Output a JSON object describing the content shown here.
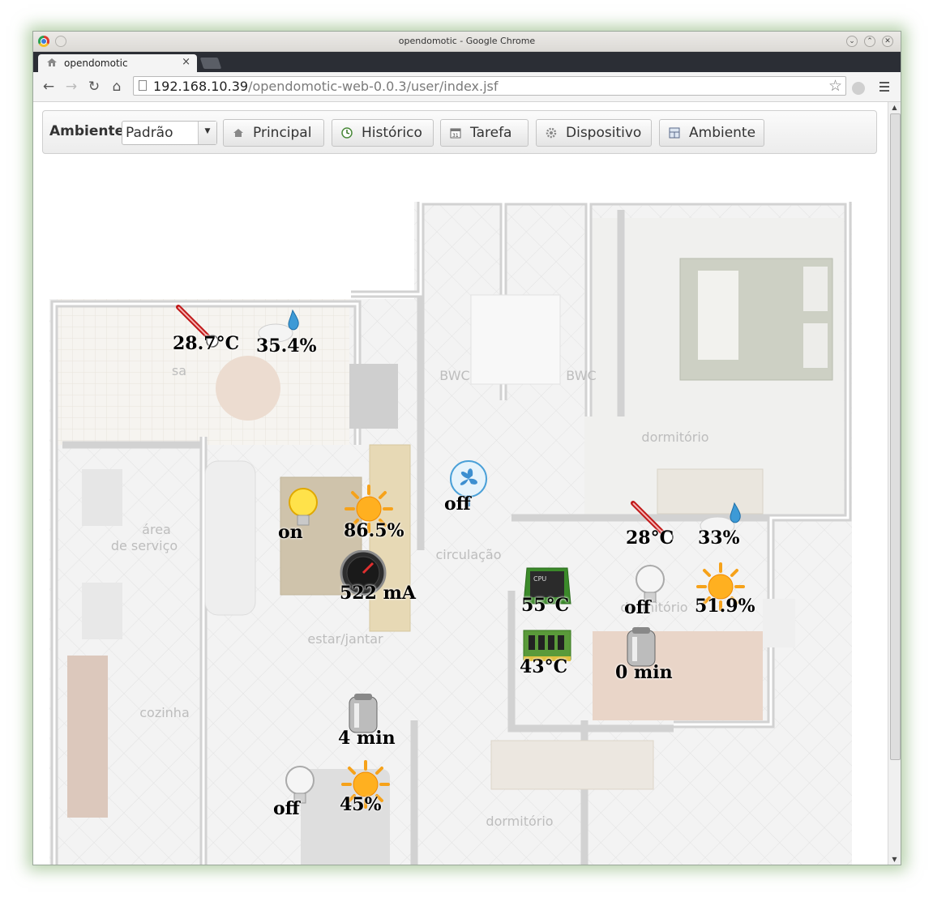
{
  "window": {
    "title": "opendomotic - Google Chrome"
  },
  "tab": {
    "label": "opendomotic",
    "close": "×"
  },
  "address": {
    "host": "192.168.10.39",
    "path": "/opendomotic-web-0.0.3/user/index.jsf"
  },
  "toolbar_icons": {
    "back": "←",
    "forward": "→",
    "reload": "↻",
    "home": "⌂",
    "star": "☆"
  },
  "menubar": {
    "ambiente_label": "Ambiente",
    "ambiente_selected": "Padrão",
    "buttons": [
      {
        "label": "Principal",
        "icon": "house-icon"
      },
      {
        "label": "Histórico",
        "icon": "history-icon"
      },
      {
        "label": "Tarefa",
        "icon": "calendar-icon"
      },
      {
        "label": "Dispositivo",
        "icon": "gear-icon"
      },
      {
        "label": "Ambiente",
        "icon": "room-icon"
      }
    ]
  },
  "floorplan": {
    "rooms": [
      "área de serviço",
      "cozinha",
      "estar/jantar",
      "circulação",
      "BWC",
      "BWC",
      "dormitório",
      "dormitório",
      "dormitório",
      "sacada"
    ]
  },
  "devices": [
    {
      "type": "thermometer-icon",
      "label": "28.7°C"
    },
    {
      "type": "humidity-icon",
      "label": "35.4%"
    },
    {
      "type": "lamp-on-icon",
      "label": "on"
    },
    {
      "type": "sun-icon",
      "label": "86.5%"
    },
    {
      "type": "fan-icon",
      "label": "off"
    },
    {
      "type": "current-gauge-icon",
      "label": "522 mA"
    },
    {
      "type": "thermometer-icon",
      "label": "28°C"
    },
    {
      "type": "humidity-icon",
      "label": "33%"
    },
    {
      "type": "cpu-icon",
      "label": "55°C"
    },
    {
      "type": "lamp-off-icon",
      "label": "off"
    },
    {
      "type": "sun-icon",
      "label": "51.9%"
    },
    {
      "type": "memory-icon",
      "label": "43°C"
    },
    {
      "type": "water-heater-icon",
      "label": "0 min"
    },
    {
      "type": "water-heater-icon",
      "label": "4 min"
    },
    {
      "type": "lamp-off-icon",
      "label": "off"
    },
    {
      "type": "sun-icon",
      "label": "45%"
    }
  ],
  "colors": {
    "window_glow": "#78aa64",
    "tabstrip": "#2b2e35",
    "wall": "#d6d6d6",
    "floor_tile": "#ececec"
  }
}
